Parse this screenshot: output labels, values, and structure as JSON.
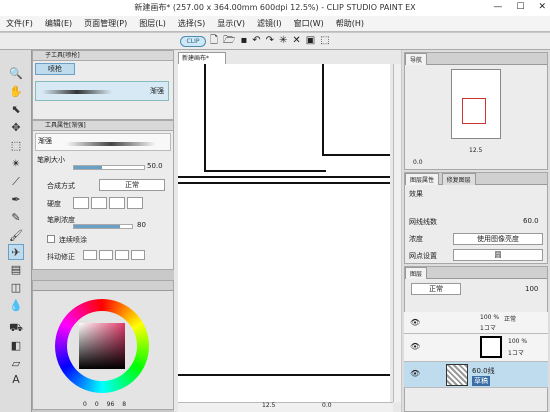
{
  "window": {
    "title": "新建画布* (257.00 x 364.00mm 600dpi 12.5%)  - CLIP STUDIO PAINT EX"
  },
  "menu": [
    "文件(F)",
    "编辑(E)",
    "页面管理(P)",
    "图层(L)",
    "选择(S)",
    "显示(V)",
    "滤镜(I)",
    "窗口(W)",
    "帮助(H)"
  ],
  "command_bar": {
    "clip_label": "CLIP"
  },
  "sub_tool": {
    "title": "子工具[喷枪]",
    "group_tab": "喷枪",
    "preset_name": "渐强"
  },
  "tool_property": {
    "title": "工具属性[渐强]",
    "preset_name": "渐强",
    "brush_size_label": "笔刷大小",
    "brush_size_value": "50.0",
    "blend_label": "合成方式",
    "blend_value": "正常",
    "hardness_label": "硬度",
    "density_label": "笔刷浓度",
    "density_value": "80",
    "continuous_label": "连续喷涂",
    "stabilizer_label": "抖动修正"
  },
  "color": {
    "readout": [
      "0",
      "0",
      "96",
      "8"
    ]
  },
  "canvas": {
    "tab_label": "新建画布*"
  },
  "status": {
    "zoom": "12.5",
    "angle": "0.0"
  },
  "navigator": {
    "tab_label": "导航",
    "zoom": "12.5",
    "angle": "0.0"
  },
  "layer_property": {
    "tabs": [
      "图层属性",
      "修复图层"
    ],
    "effect_label": "效果",
    "line_count_label": "网线线数",
    "line_count_value": "60.0",
    "density_label": "浓度",
    "density_value": "使用图像亮度",
    "screen_setting_label": "网点设置",
    "screen_setting_value": "圆"
  },
  "layers": {
    "tab_label": "图层",
    "blend_mode": "正常",
    "opacity": "100",
    "items": [
      {
        "line1": "100 %",
        "line2": "正常",
        "line3": "1コマ"
      },
      {
        "line1": "100 %",
        "line2": "",
        "line3": "1コマ"
      },
      {
        "line1": "60.0线",
        "line2": "草稿",
        "line3": ""
      }
    ]
  }
}
